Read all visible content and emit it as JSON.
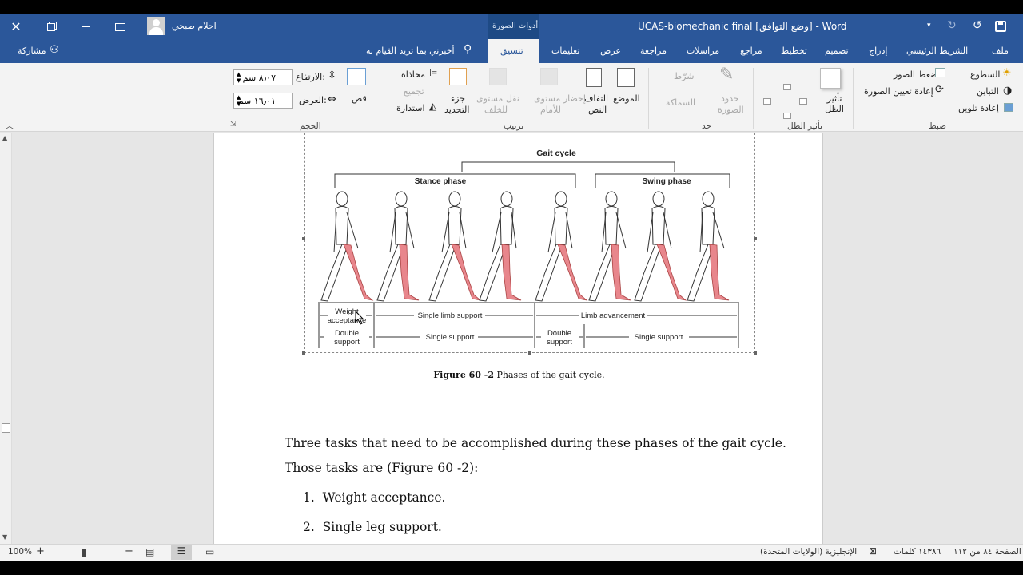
{
  "titlebar": {
    "title": "UCAS-biomechanic final  [وضع التوافق]  -  Word",
    "context_tab": "أدوات الصورة",
    "user_name": "احلام صبحي"
  },
  "tabs": [
    "ملف",
    "الشريط الرئيسي",
    "إدراج",
    "تصميم",
    "تخطيط",
    "مراجع",
    "مراسلات",
    "مراجعة",
    "عرض",
    "تعليمات",
    "تنسيق"
  ],
  "tell_me": "أخبرني بما تريد القيام به",
  "share": "مشاركة",
  "ribbon": {
    "adjust": {
      "group": "ضبط",
      "corrections": "السطوع",
      "color": "التباين",
      "artistic": "إعادة تلوين",
      "compress": "ضغط الصور",
      "reset": "إعادة تعيين الصورة"
    },
    "shadow": {
      "group": "تأثير الظل",
      "effects": "تأثير الظل"
    },
    "border": {
      "group": "حد",
      "border_line1": "حدود",
      "border_line2": "الصورة",
      "style1": "شرّط",
      "style2": "السماكة"
    },
    "arrange": {
      "group": "ترتيب",
      "position": "الموضع",
      "wrap_line1": "التفاف",
      "wrap_line2": "النص",
      "forward_line1": "إحضار مستوى",
      "forward_line2": "للأمام",
      "backward_line1": "نقل مستوى",
      "backward_line2": "للخلف",
      "selection_line1": "جزء",
      "selection_line2": "التحديد",
      "align": "محاذاة",
      "group_btn": "تجميع",
      "rotate": "استدارة"
    },
    "size": {
      "group": "الحجم",
      "crop": "قص",
      "height_label": "الارتفاع:",
      "height_value": "٨٫٠٧ سم",
      "width_label": "العرض:",
      "width_value": "١٦٫٠١ سم"
    }
  },
  "figure": {
    "title": "Gait cycle",
    "stance": "Stance phase",
    "swing": "Swing phase",
    "row1": [
      "Weight acceptance",
      "Single limb support",
      "Limb advancement"
    ],
    "row2": [
      "Double support",
      "Single support",
      "Double support",
      "Single support"
    ],
    "caption_bold": "Figure 60 -2",
    "caption_rest": "Phases of the gait cycle."
  },
  "body": {
    "para_line1": "Three tasks that need to be accomplished during these phases of the gait cycle.",
    "para_line2": "Those tasks are (Figure 60 -2):",
    "list": [
      {
        "num": "1.",
        "text": "Weight acceptance."
      },
      {
        "num": "2.",
        "text": "Single leg support."
      }
    ]
  },
  "status": {
    "page": "الصفحة ٨٤ من ١١٢",
    "words": "١٤٣٨٦ كلمات",
    "language": "الإنجليزية (الولايات المتحدة)",
    "zoom": "100%"
  },
  "colors": {
    "accent": "#2b579a",
    "limb": "#e8868c"
  }
}
